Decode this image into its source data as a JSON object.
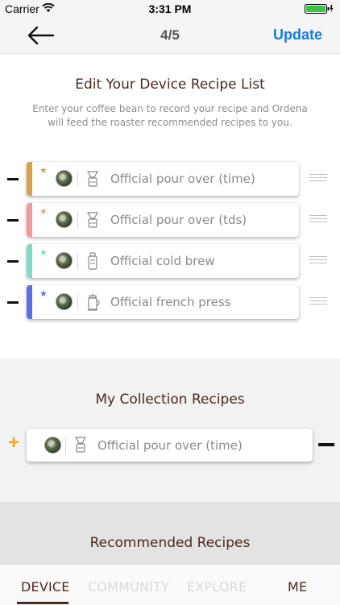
{
  "status_bar": {
    "carrier": "Carrier",
    "time": "3:31 PM"
  },
  "nav": {
    "step": "4/5",
    "update_label": "Update"
  },
  "device_section": {
    "title": "Edit Your Device Recipe List",
    "description": "Enter your coffee bean to record your recipe and Ordena will feed the roaster recommended recipes to you.",
    "recipes": [
      {
        "name": "Official pour over (time)",
        "stripe_color": "#d9a24a",
        "star": "★",
        "device_icon": "pour-over-icon"
      },
      {
        "name": "Official pour over (tds)",
        "stripe_color": "#f39a9a",
        "star": "★",
        "device_icon": "pour-over-icon"
      },
      {
        "name": "Official cold brew",
        "stripe_color": "#7ddcc6",
        "star": "★",
        "device_icon": "cold-brew-icon"
      },
      {
        "name": "Official french press",
        "stripe_color": "#5a6fe6",
        "star": "★",
        "device_icon": "french-press-icon"
      }
    ]
  },
  "collection_section": {
    "title": "My Collection Recipes",
    "add_symbol": "+",
    "recipes": [
      {
        "name": "Official pour over (time)",
        "device_icon": "pour-over-icon"
      }
    ]
  },
  "recommended_section": {
    "title": "Recommended Recipes"
  },
  "tabs": [
    {
      "label": "DEVICE",
      "state": "active"
    },
    {
      "label": "COMMUNITY",
      "state": "inactive"
    },
    {
      "label": "EXPLORE",
      "state": "inactive"
    },
    {
      "label": "ME",
      "state": "normal"
    }
  ]
}
